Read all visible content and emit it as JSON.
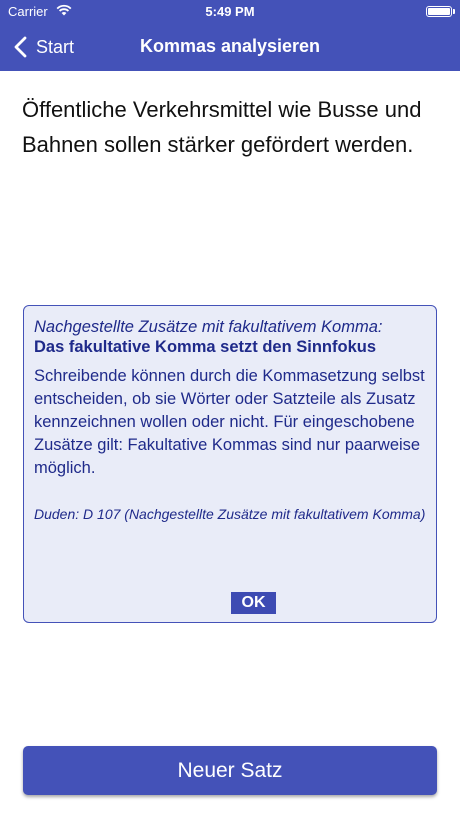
{
  "status_bar": {
    "carrier": "Carrier",
    "time": "5:49 PM"
  },
  "nav": {
    "back_label": "Start",
    "title": "Kommas analysieren"
  },
  "sentence": "Öffentliche Verkehrsmittel wie Busse und Bahnen sollen stärker gefördert werden.",
  "info": {
    "subtitle": "Nachgestellte Zusätze mit fakultativem Komma:",
    "title": "Das fakultative Komma setzt den Sinnfokus",
    "body": "Schreibende können durch die Kommasetzung selbst entscheiden, ob sie Wörter oder Satzteile als Zusatz kennzeichnen wollen oder nicht. Für eingeschobene Zusätze gilt: Fakultative Kommas sind nur paarweise möglich.",
    "reference": "Duden: D 107 (Nachgestellte Zusätze mit fakultativem Komma)",
    "ok_label": "OK"
  },
  "new_sentence_label": "Neuer Satz",
  "colors": {
    "accent": "#4452b8",
    "info_background": "#e9ecf8",
    "info_text": "#1f2a8a"
  },
  "icons": {
    "back": "chevron-left-icon",
    "wifi": "wifi-icon",
    "battery": "battery-icon"
  }
}
